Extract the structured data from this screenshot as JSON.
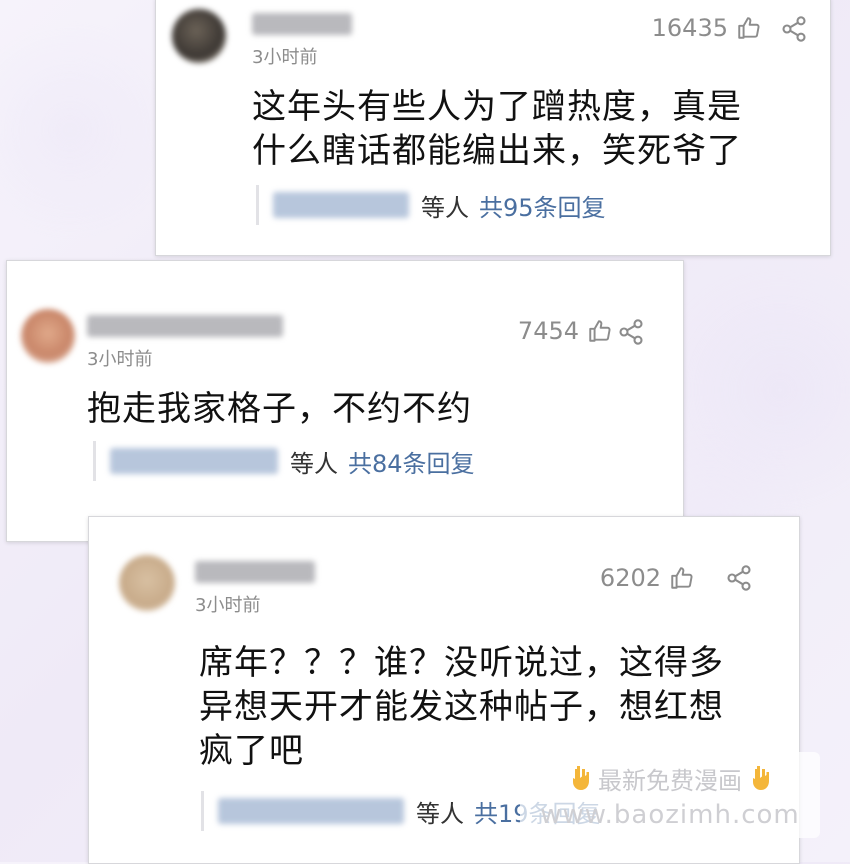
{
  "comments": [
    {
      "time": "3小时前",
      "likes": "16435",
      "content_lines": [
        "这年头有些人为了蹭热度，真是",
        "什么瞎话都能编出来，笑死爷了"
      ],
      "reply_suffix": "等人",
      "reply_count": "共95条回复"
    },
    {
      "time": "3小时前",
      "likes": "7454",
      "content_lines": [
        "抱走我家格子，不约不约"
      ],
      "reply_suffix": "等人",
      "reply_count": "共84条回复"
    },
    {
      "time": "3小时前",
      "likes": "6202",
      "content_lines": [
        "席年？？？谁？没听说过，这得多",
        "异想天开才能发这种帖子，想红想",
        "疯了吧"
      ],
      "reply_suffix": "等人",
      "reply_count": "共19条回复"
    }
  ],
  "watermark": {
    "line1": "最新免费漫画",
    "line2": "www.baozimh.com"
  },
  "icons": {
    "like": "thumbs-up-icon",
    "share": "share-icon",
    "watermark": "pointing-down-hand-icon"
  },
  "colors": {
    "reply_count": "#4a6fa0",
    "meta_text": "#8c8c8c",
    "background": "#f3f0f9"
  }
}
